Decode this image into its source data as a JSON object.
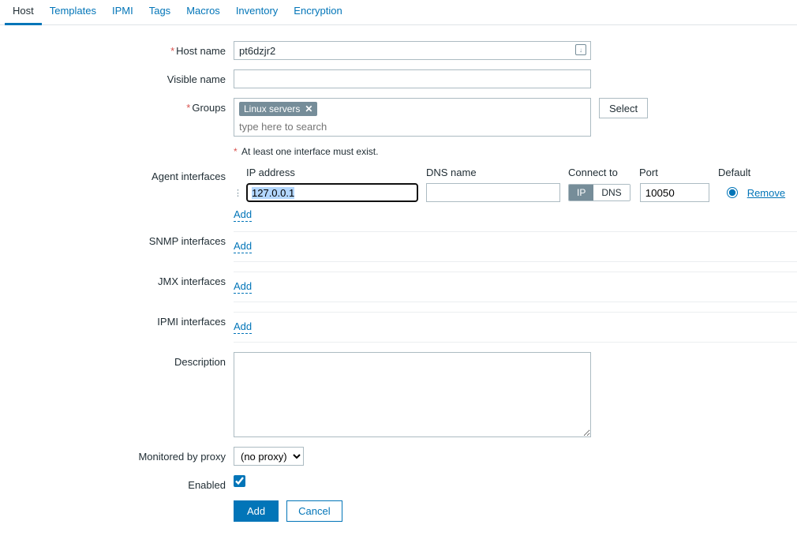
{
  "tabs": {
    "host": "Host",
    "templates": "Templates",
    "ipmi": "IPMI",
    "tags": "Tags",
    "macros": "Macros",
    "inventory": "Inventory",
    "encryption": "Encryption"
  },
  "labels": {
    "hostname": "Host name",
    "visible_name": "Visible name",
    "groups": "Groups",
    "agent_interfaces": "Agent interfaces",
    "snmp_interfaces": "SNMP interfaces",
    "jmx_interfaces": "JMX interfaces",
    "ipmi_interfaces": "IPMI interfaces",
    "description": "Description",
    "monitored_by_proxy": "Monitored by proxy",
    "enabled": "Enabled"
  },
  "iface_headers": {
    "ip": "IP address",
    "dns": "DNS name",
    "connect": "Connect to",
    "port": "Port",
    "default": "Default"
  },
  "values": {
    "hostname": "pt6dzjr2",
    "visible_name": "",
    "group_tag": "Linux servers",
    "groups_placeholder": "type here to search",
    "select_btn": "Select",
    "interface_hint": "At least one interface must exist.",
    "agent_ip": "127.0.0.1",
    "agent_dns": "",
    "connect_ip": "IP",
    "connect_dns": "DNS",
    "agent_port": "10050",
    "remove": "Remove",
    "add": "Add",
    "proxy": "(no proxy)",
    "cancel": "Cancel",
    "submit_add": "Add"
  }
}
